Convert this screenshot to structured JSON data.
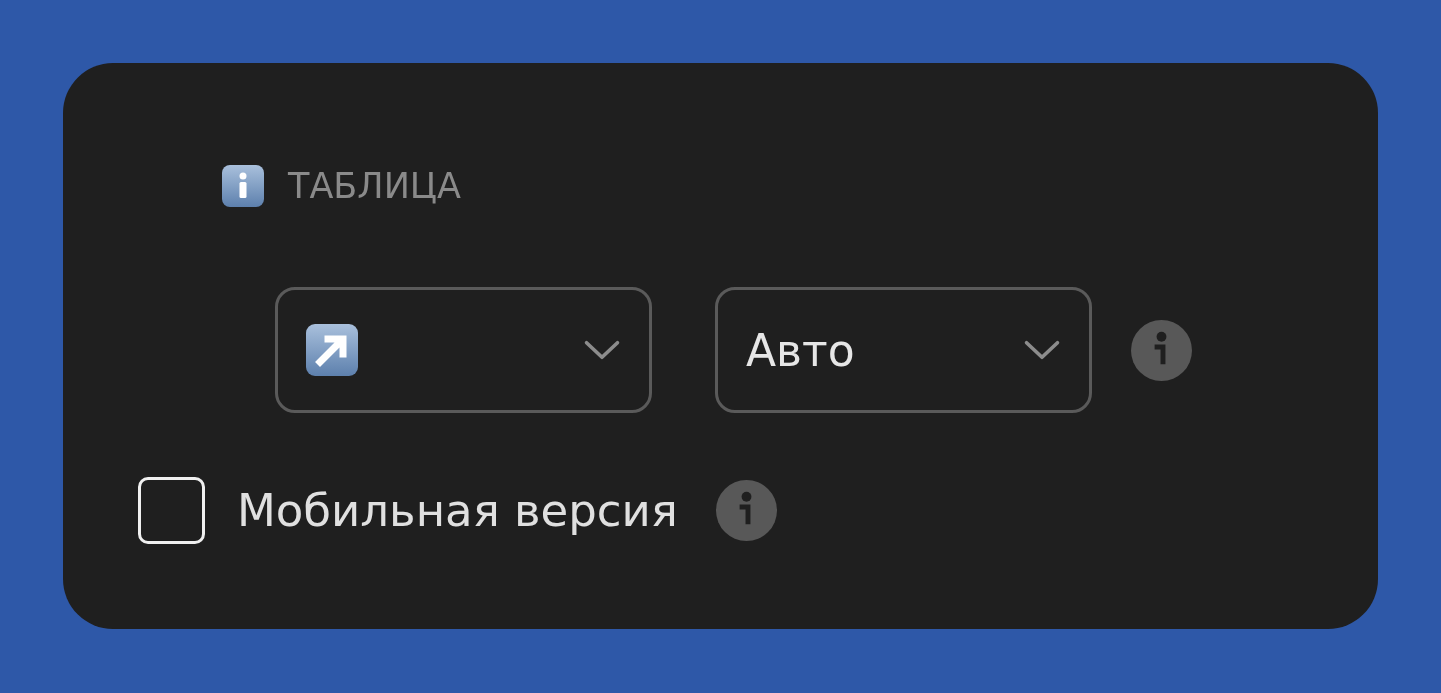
{
  "section": {
    "title": "ТАБЛИЦА"
  },
  "dropdowns": [
    {
      "kind": "icon"
    },
    {
      "kind": "text",
      "value": "Авто"
    }
  ],
  "checkbox": {
    "label": "Мобильная версия",
    "checked": false
  }
}
